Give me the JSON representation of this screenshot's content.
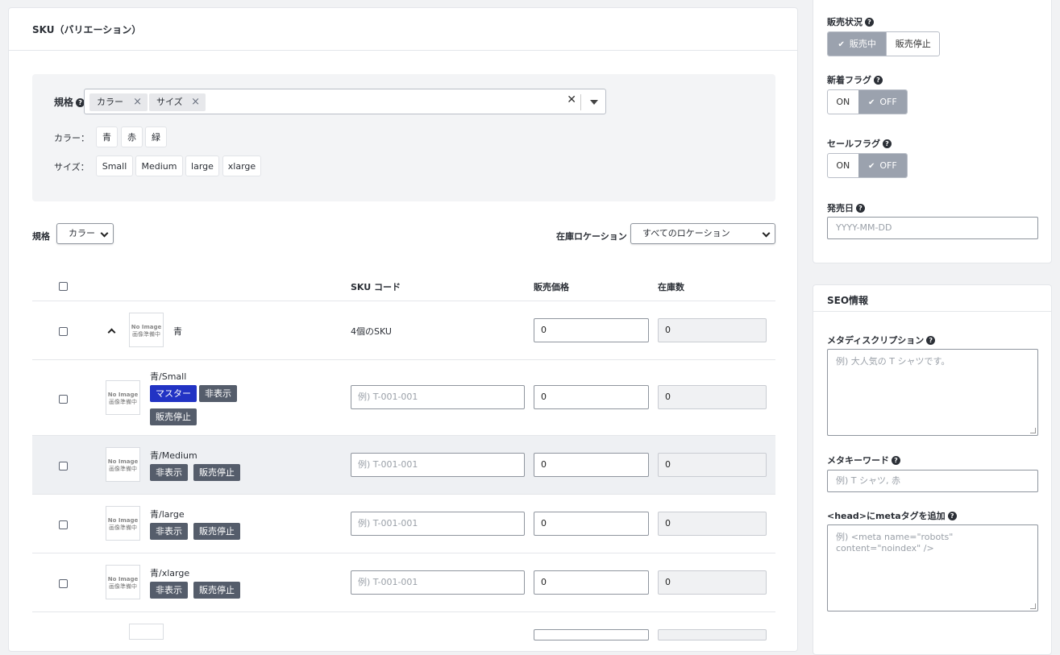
{
  "sku_card": {
    "title": "SKU（バリエーション）",
    "spec_label": "規格",
    "spec_chips": [
      "カラー",
      "サイズ"
    ],
    "color_label": "カラー：",
    "color_options": [
      "青",
      "赤",
      "緑"
    ],
    "size_label": "サイズ：",
    "size_options": [
      "Small",
      "Medium",
      "large",
      "xlarge"
    ]
  },
  "filters": {
    "spec_label": "規格",
    "spec_value": "カラー",
    "location_label": "在庫ロケーション",
    "location_value": "すべてのロケーション"
  },
  "table": {
    "headers": {
      "sku_code": "SKU コード",
      "price": "販売価格",
      "stock": "在庫数"
    },
    "group": {
      "name": "青",
      "sku_count": "4個のSKU",
      "price": "0",
      "stock": "0"
    },
    "code_placeholder": "例) T-001-001",
    "rows": [
      {
        "name": "青/Small",
        "badges": [
          "マスター",
          "非表示",
          "販売停止"
        ],
        "price": "0",
        "stock": "0"
      },
      {
        "name": "青/Medium",
        "badges": [
          "非表示",
          "販売停止"
        ],
        "price": "0",
        "stock": "0"
      },
      {
        "name": "青/large",
        "badges": [
          "非表示",
          "販売停止"
        ],
        "price": "0",
        "stock": "0"
      },
      {
        "name": "青/xlarge",
        "badges": [
          "非表示",
          "販売停止"
        ],
        "price": "0",
        "stock": "0"
      }
    ],
    "noimage_text": "No Image",
    "noimage_sub": "画像準備中"
  },
  "sidebar": {
    "sale_status_label": "販売状況",
    "sale_status_options": [
      "販売中",
      "販売停止"
    ],
    "new_flag_label": "新着フラグ",
    "new_flag_options": [
      "ON",
      "OFF"
    ],
    "sale_flag_label": "セールフラグ",
    "sale_flag_options": [
      "ON",
      "OFF"
    ],
    "release_date_label": "発売日",
    "release_date_placeholder": "YYYY-MM-DD"
  },
  "seo": {
    "title": "SEO情報",
    "meta_description_label": "メタディスクリプション",
    "meta_description_placeholder": "例) 大人気の T シャツです。",
    "meta_keywords_label": "メタキーワード",
    "meta_keywords_placeholder": "例) T シャツ, 赤",
    "head_meta_label": "<head>にmetaタグを追加",
    "head_meta_placeholder": "例) <meta name=\"robots\" content=\"noindex\" />"
  }
}
